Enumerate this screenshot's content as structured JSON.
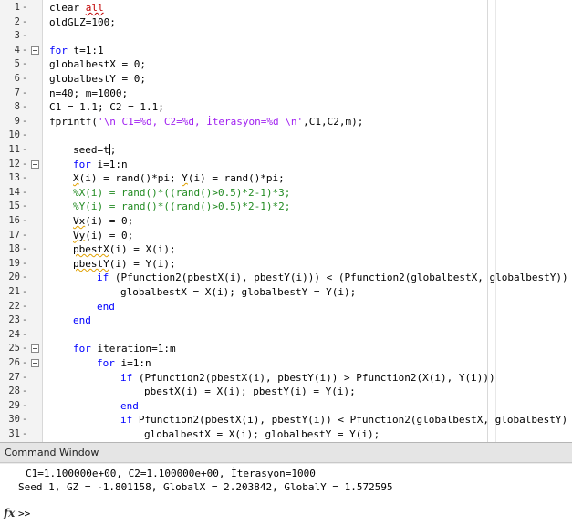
{
  "editor": {
    "lines": [
      {
        "n": "1",
        "fold": false,
        "indent": 54,
        "html": "clear <span class='red'>all</span>"
      },
      {
        "n": "2",
        "fold": false,
        "indent": 54,
        "html": "oldGLZ=100;"
      },
      {
        "n": "3",
        "fold": false,
        "indent": 54,
        "html": ""
      },
      {
        "n": "4",
        "fold": true,
        "indent": 54,
        "html": "<span class='kw'>for</span> t=1:1"
      },
      {
        "n": "5",
        "fold": false,
        "indent": 54,
        "html": "globalbestX = 0;"
      },
      {
        "n": "6",
        "fold": false,
        "indent": 54,
        "html": "globalbestY = 0;"
      },
      {
        "n": "7",
        "fold": false,
        "indent": 54,
        "html": "n=40; m=1000;"
      },
      {
        "n": "8",
        "fold": false,
        "indent": 54,
        "html": "C1 = 1.1; C2 = 1.1;"
      },
      {
        "n": "9",
        "fold": false,
        "indent": 54,
        "html": "fprintf(<span class='str'>'\\n C1=%d, C2=%d, İterasyon=%d \\n'</span>,C1,C2,m);"
      },
      {
        "n": "10",
        "fold": false,
        "indent": 54,
        "html": ""
      },
      {
        "n": "11",
        "fold": false,
        "indent": 80,
        "html": "seed=t<span class='cursor'></span>;"
      },
      {
        "n": "12",
        "fold": true,
        "indent": 80,
        "html": "<span class='kw'>for</span> i=1:n"
      },
      {
        "n": "13",
        "fold": false,
        "indent": 80,
        "html": "<span class='sq'>X</span>(i) = rand()*pi; <span class='sq'>Y</span>(i) = rand()*pi;"
      },
      {
        "n": "14",
        "fold": false,
        "indent": 80,
        "html": "<span class='cm'>%X(i) = rand()*((rand()&gt;0.5)*2-1)*3;</span>"
      },
      {
        "n": "15",
        "fold": false,
        "indent": 80,
        "html": "<span class='cm'>%Y(i) = rand()*((rand()&gt;0.5)*2-1)*2;</span>"
      },
      {
        "n": "16",
        "fold": false,
        "indent": 80,
        "html": "<span class='sq'>Vx</span>(i) = 0;"
      },
      {
        "n": "17",
        "fold": false,
        "indent": 80,
        "html": "<span class='sq'>Vy</span>(i) = 0;"
      },
      {
        "n": "18",
        "fold": false,
        "indent": 80,
        "html": "<span class='sq'>pbestX</span>(i) = X(i);"
      },
      {
        "n": "19",
        "fold": false,
        "indent": 80,
        "html": "<span class='sq'>pbestY</span>(i) = Y(i);"
      },
      {
        "n": "20",
        "fold": false,
        "indent": 106,
        "html": "<span class='kw'>if</span> (Pfunction2(pbestX(i), pbestY(i))) &lt; (Pfunction2(globalbestX, globalbestY))"
      },
      {
        "n": "21",
        "fold": false,
        "indent": 132,
        "html": "globalbestX = X(i); globalbestY = Y(i);"
      },
      {
        "n": "22",
        "fold": false,
        "indent": 106,
        "html": "<span class='kw'>end</span>"
      },
      {
        "n": "23",
        "fold": false,
        "indent": 80,
        "html": "<span class='kw'>end</span>"
      },
      {
        "n": "24",
        "fold": false,
        "indent": 80,
        "html": ""
      },
      {
        "n": "25",
        "fold": true,
        "indent": 80,
        "html": "<span class='kw'>for</span> iteration=1:m"
      },
      {
        "n": "26",
        "fold": true,
        "indent": 106,
        "html": "<span class='kw'>for</span> i=1:n"
      },
      {
        "n": "27",
        "fold": false,
        "indent": 132,
        "html": "<span class='kw'>if</span> (Pfunction2(pbestX(i), pbestY(i)) &gt; Pfunction2(X(i), Y(i)))"
      },
      {
        "n": "28",
        "fold": false,
        "indent": 158,
        "html": "pbestX(i) = X(i); pbestY(i) = Y(i);"
      },
      {
        "n": "29",
        "fold": false,
        "indent": 132,
        "html": "<span class='kw'>end</span>"
      },
      {
        "n": "30",
        "fold": false,
        "indent": 132,
        "html": "<span class='kw'>if</span> Pfunction2(pbestX(i), pbestY(i)) &lt; Pfunction2(globalbestX, globalbestY)"
      },
      {
        "n": "31",
        "fold": false,
        "indent": 158,
        "html": "globalbestX = X(i); globalbestY = Y(i);"
      }
    ]
  },
  "command_window": {
    "title": "Command Window",
    "output": [
      "C1=1.100000e+00, C2=1.100000e+00, İterasyon=1000",
      "Seed 1, GZ = -1.801158, GlobalX = 2.203842, GlobalY = 1.572595"
    ],
    "fx_symbol": "fx",
    "prompt": ">>"
  }
}
